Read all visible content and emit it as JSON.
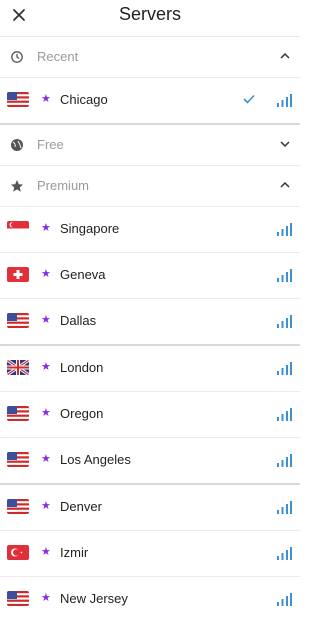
{
  "header": {
    "title": "Servers",
    "close_icon": "close-icon"
  },
  "sections": {
    "recent": {
      "label": "Recent",
      "icon": "history-icon",
      "expanded": true
    },
    "free": {
      "label": "Free",
      "icon": "globe-icon",
      "expanded": false
    },
    "premium": {
      "label": "Premium",
      "icon": "star-icon",
      "expanded": true
    }
  },
  "recent_servers": [
    {
      "city": "Chicago",
      "flag": "us-flag-icon",
      "selected": true
    }
  ],
  "premium_servers": [
    {
      "city": "Singapore",
      "flag": "singapore-flag-icon"
    },
    {
      "city": "Geneva",
      "flag": "switzerland-flag-icon"
    },
    {
      "city": "Dallas",
      "flag": "us-flag-icon"
    },
    {
      "city": "London",
      "flag": "uk-flag-icon"
    },
    {
      "city": "Oregon",
      "flag": "us-flag-icon"
    },
    {
      "city": "Los Angeles",
      "flag": "us-flag-icon"
    },
    {
      "city": "Denver",
      "flag": "us-flag-icon"
    },
    {
      "city": "Izmir",
      "flag": "turkey-flag-icon"
    },
    {
      "city": "New Jersey",
      "flag": "us-flag-icon"
    }
  ],
  "colors": {
    "accent_purple": "#8a2be2",
    "signal_blue": "#3d8fd8"
  }
}
